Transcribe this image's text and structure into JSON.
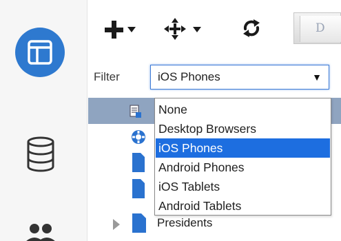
{
  "rail": {
    "items": [
      {
        "name": "layout",
        "icon": "layout-icon",
        "active": true
      },
      {
        "name": "data",
        "icon": "database-icon",
        "active": false
      },
      {
        "name": "users",
        "icon": "users-icon",
        "active": false
      }
    ]
  },
  "toolbar": {
    "buttons": [
      {
        "name": "add",
        "icon": "plus-icon",
        "has_dropdown": true
      },
      {
        "name": "move",
        "icon": "move-icon",
        "has_dropdown": true
      },
      {
        "name": "refresh",
        "icon": "refresh-icon",
        "has_dropdown": false
      }
    ],
    "tab_label": "D"
  },
  "filter": {
    "label": "Filter",
    "selected": "iOS Phones",
    "options": [
      "None",
      "Desktop Browsers",
      "iOS Phones",
      "Android Phones",
      "iOS Tablets",
      "Android Tablets"
    ],
    "selected_index": 2
  },
  "tree": {
    "rows": [
      {
        "icon": "page-list-icon",
        "label": "",
        "selected": true
      },
      {
        "icon": "settings-badge-icon",
        "label": "",
        "selected": false
      },
      {
        "icon": "page-icon",
        "label": "",
        "selected": false
      },
      {
        "icon": "page-icon",
        "label": "",
        "selected": false
      },
      {
        "icon": "page-icon",
        "label": "Presidents",
        "selected": false,
        "expandable": true
      }
    ]
  },
  "colors": {
    "accent": "#2e79cf",
    "selection": "#1d6ee0",
    "tree_selected": "#8fa4c0",
    "page_icon": "#2a72cf"
  }
}
